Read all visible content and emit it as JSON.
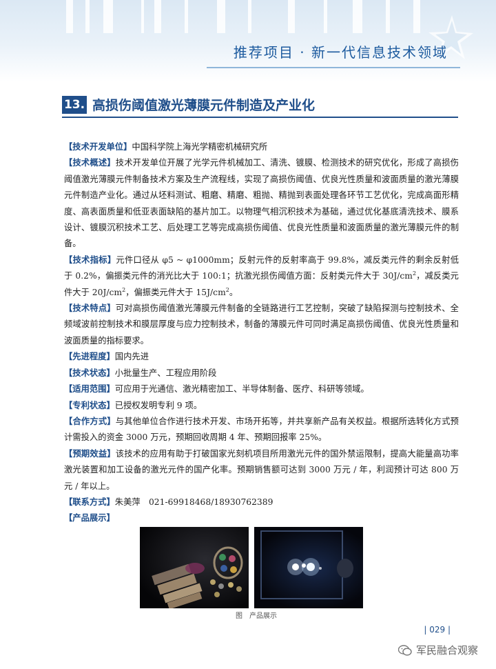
{
  "header": {
    "title": "推荐项目 · 新一代信息技术领域"
  },
  "section": {
    "number": "13.",
    "title": "高损伤阈值激光薄膜元件制造及产业化"
  },
  "entries": [
    {
      "label": "【技术开发单位】",
      "text": "中国科学院上海光学精密机械研究所"
    },
    {
      "label": "【技术概述】",
      "text": "技术开发单位开展了光学元件机械加工、清洗、镀膜、检测技术的研究优化，形成了高损伤阈值激光薄膜元件制备技术方案及生产流程线，实现了高损伤阈值、优良光性质量和波面质量的激光薄膜元件制造产业化。通过从坯料测试、粗磨、精磨、粗抛、精抛到表面处理各环节工艺优化，完成高面形精度、高表面质量和低亚表面缺陷的基片加工。以物理气相沉积技术为基础，通过优化基底清洗技术、膜系设计、镀膜沉积技术工艺、后处理工艺等完成高损伤阈值、优良光性质量和波面质量的激光薄膜元件的制备。"
    },
    {
      "label": "【技术指标】",
      "text_a": "元件口径从 φ5 ~ φ1000mm；反射元件的反射率高于 99.8%，减反类元件的剩余反射低于 0.2%，偏振类元件的消光比大于 100:1；抗激光损伤阈值方面：反射类元件大于 30J/cm",
      "sup_a": "2",
      "text_b": "，减反类元件大于 20J/cm",
      "sup_b": "2",
      "text_c": "，偏振类元件大于 15J/cm",
      "sup_c": "2",
      "text_d": "。"
    },
    {
      "label": "【技术特点】",
      "text": "可对高损伤阈值激光薄膜元件制备的全链路进行工艺控制，突破了缺陷探测与控制技术、全频域波前控制技术和膜层厚度与应力控制技术，制备的薄膜元件可同时满足高损伤阈值、优良光性质量和波面质量的指标要求。"
    },
    {
      "label": "【先进程度】",
      "text": "国内先进"
    },
    {
      "label": "【技术状态】",
      "text": "小批量生产、工程应用阶段"
    },
    {
      "label": "【适用范围】",
      "text": "可应用于光通信、激光精密加工、半导体制备、医疗、科研等领域。"
    },
    {
      "label": "【专利状态】",
      "text": "已授权发明专利 9 项。"
    },
    {
      "label": "【合作方式】",
      "text": "与其他单位合作进行技术开发、市场开拓等，并共享新产品有关权益。根据所选转化方式预计需投入的资金 3000 万元，预期回收周期 4 年、预期回报率 25%。"
    },
    {
      "label": "【预期效益】",
      "text": "该技术的应用有助于打破国家光刻机项目所用激光元件的国外禁运限制，提高大能量高功率激光装置和加工设备的激光元件的国产化率。预期销售额可达到 3000 万元 / 年，利润预计可达 800 万元 / 年以上。"
    },
    {
      "label": "【联系方式】",
      "text": "朱美萍　021-69918468/18930762389"
    },
    {
      "label": "【产品展示】",
      "text": ""
    }
  ],
  "figure": {
    "caption": "图　产品展示",
    "left_image": "laser-optics-elements-photo",
    "right_image": "laser-beam-spots-photo"
  },
  "footer": {
    "page_number": "| 029 |",
    "watermark": "军民融合观察",
    "watermark_icon": "wechat-icon"
  },
  "colors": {
    "accent": "#1f4e8a",
    "header_text": "#1c5a9e",
    "header_bg": "#dbe8f4"
  }
}
